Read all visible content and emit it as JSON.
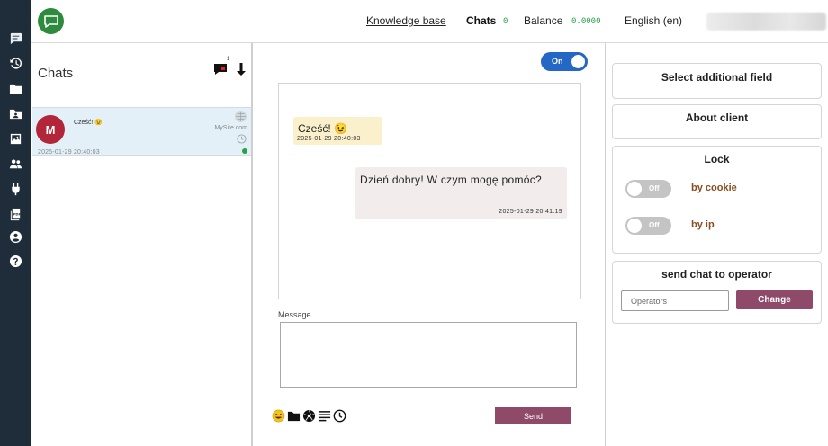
{
  "nav": {
    "items": [
      {
        "icon": "chat-icon",
        "active": true
      },
      {
        "icon": "history-icon"
      },
      {
        "icon": "folder-icon"
      },
      {
        "icon": "folder-user-icon"
      },
      {
        "icon": "image-icon"
      },
      {
        "icon": "users-icon"
      },
      {
        "icon": "plug-icon"
      },
      {
        "icon": "pdf-icon"
      },
      {
        "icon": "account-icon"
      },
      {
        "icon": "help-icon"
      }
    ]
  },
  "header": {
    "knowledge_base": "Knowledge base",
    "chats_label": "Chats",
    "chats_count": "0",
    "balance_label": "Balance",
    "balance_value": "0.0000",
    "language": "English (en)",
    "brand_color": "#2e8b3e"
  },
  "chats": {
    "title": "Chats",
    "new_chat_badge": "1",
    "items": [
      {
        "avatar_letter": "M",
        "message": "Cześć! 😉",
        "site": "MySite.com",
        "time": "2025-01-29 20:40:03",
        "status": "online",
        "status_color": "#2aa046"
      }
    ]
  },
  "conversation": {
    "toggle_label": "On",
    "messages": [
      {
        "direction": "incoming",
        "text": "Cześć! 😉",
        "time": "2025-01-29 20:40:03"
      },
      {
        "direction": "outgoing",
        "text": "Dzień dobry! W czym mogę pomóc?",
        "time": "2025-01-29 20:41:19"
      }
    ],
    "message_label": "Message",
    "message_value": "",
    "send_label": "Send",
    "tools": [
      "emoji-icon",
      "folder-icon",
      "aperture-icon",
      "text-lines-icon",
      "clock-icon"
    ]
  },
  "right_panel": {
    "select_field": "Select additional field",
    "about_client": "About client",
    "lock": {
      "title": "Lock",
      "cookie_toggle": "Off",
      "cookie_label": "by cookie",
      "ip_toggle": "Off",
      "ip_label": "by ip"
    },
    "send_operator": {
      "title": "send chat to operator",
      "placeholder": "Operators",
      "change_label": "Change"
    }
  },
  "colors": {
    "sidebar": "#1f2d3a",
    "accent_button": "#8f4a6a",
    "toggle_on": "#2467c4",
    "toggle_off": "#c4c4c4",
    "lock_label": "#8a4b1e",
    "selected_chat": "#e3f0f8",
    "incoming_bubble": "#faf0cc",
    "outgoing_bubble": "#f2eced"
  }
}
